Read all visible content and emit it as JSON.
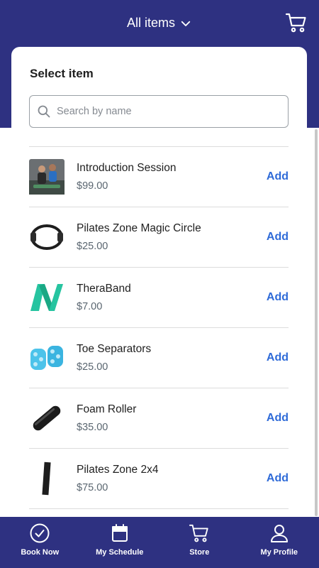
{
  "header": {
    "title": "All items",
    "cart_icon": "cart-icon",
    "dropdown_icon": "chevron-down-icon"
  },
  "card": {
    "title": "Select item",
    "search": {
      "placeholder": "Search by name",
      "value": ""
    }
  },
  "items": [
    {
      "name": "Introduction Session",
      "price": "$99.00",
      "action": "Add",
      "image": "session-photo"
    },
    {
      "name": "Pilates Zone Magic Circle",
      "price": "$25.00",
      "action": "Add",
      "image": "magic-circle-image"
    },
    {
      "name": "TheraBand",
      "price": "$7.00",
      "action": "Add",
      "image": "theraband-image"
    },
    {
      "name": "Toe Separators",
      "price": "$25.00",
      "action": "Add",
      "image": "toe-separators-image"
    },
    {
      "name": "Foam Roller",
      "price": "$35.00",
      "action": "Add",
      "image": "foam-roller-image"
    },
    {
      "name": "Pilates Zone 2x4",
      "price": "$75.00",
      "action": "Add",
      "image": "2x4-image"
    }
  ],
  "bottom_nav": [
    {
      "label": "Book Now",
      "icon": "check-circle-icon"
    },
    {
      "label": "My Schedule",
      "icon": "calendar-icon"
    },
    {
      "label": "Store",
      "icon": "cart-icon"
    },
    {
      "label": "My Profile",
      "icon": "user-icon"
    }
  ],
  "colors": {
    "brand": "#2e3181",
    "link": "#2f6bd8",
    "price": "#5a6670"
  }
}
